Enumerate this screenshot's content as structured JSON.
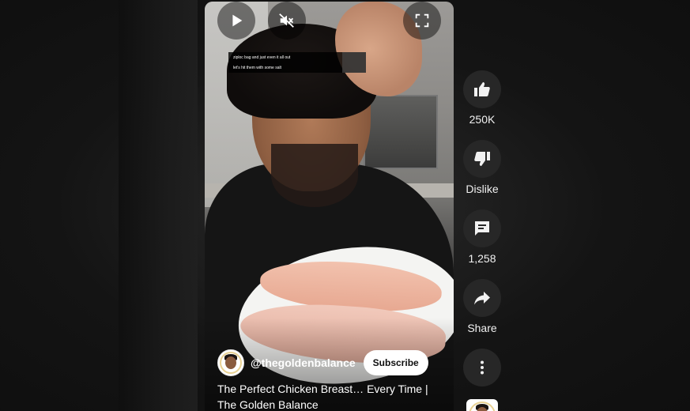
{
  "player": {
    "controls": {
      "play_icon": "play-icon",
      "mute_icon": "volume-off-icon",
      "fullscreen_icon": "fullscreen-icon"
    },
    "caption_lines": [
      "ziploc bag and just even it all out",
      "let's hit them with some salt"
    ],
    "channel": {
      "handle": "@thegoldenbalance",
      "subscribe_label": "Subscribe"
    },
    "title": "The Perfect Chicken Breast… Every Time | The Golden Balance"
  },
  "actions": {
    "like": {
      "icon": "thumbs-up-icon",
      "label": "250K"
    },
    "dislike": {
      "icon": "thumbs-down-icon",
      "label": "Dislike"
    },
    "comments": {
      "icon": "comment-icon",
      "label": "1,258"
    },
    "share": {
      "icon": "share-icon",
      "label": "Share"
    },
    "more": {
      "icon": "more-vertical-icon"
    }
  },
  "colors": {
    "background": "#0f0f0f",
    "action_button": "#272727",
    "subscribe_bg": "#ffffff",
    "text": "#f1f1f1"
  }
}
